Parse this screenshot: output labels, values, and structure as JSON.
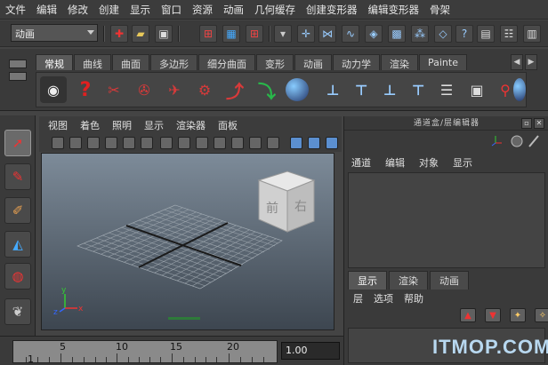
{
  "menubar": {
    "items": [
      "文件",
      "编辑",
      "修改",
      "创建",
      "显示",
      "窗口",
      "资源",
      "动画",
      "几何缓存",
      "创建变形器",
      "编辑变形器",
      "骨架"
    ]
  },
  "statusline": {
    "mode_value": "动画"
  },
  "shelf": {
    "tabs": [
      "常规",
      "曲线",
      "曲面",
      "多边形",
      "细分曲面",
      "变形",
      "动画",
      "动力学",
      "渲染",
      "Painte"
    ],
    "active_tab": "常规"
  },
  "panel": {
    "menu": [
      "视图",
      "着色",
      "照明",
      "显示",
      "渲染器",
      "面板"
    ],
    "view_cube_labels": [
      "前",
      "右"
    ]
  },
  "timeline": {
    "ticks": [
      "5",
      "10",
      "15",
      "20"
    ],
    "start_label": "1",
    "current_value": "1.00"
  },
  "right_panel": {
    "title": "通道盒/层编辑器",
    "channel_menu": [
      "通道",
      "编辑",
      "对象",
      "显示"
    ],
    "layer_tabs": [
      "显示",
      "渲染",
      "动画"
    ],
    "active_layer_tab": "显示",
    "layer_menu": [
      "层",
      "选项",
      "帮助"
    ]
  },
  "watermark": {
    "text": "ITMOP.COM"
  },
  "colors": {
    "accent_blue": "#4da3ff",
    "accent_red": "#c0282a",
    "viewport_top": "#7d8b99",
    "viewport_bottom": "#3d4650"
  }
}
